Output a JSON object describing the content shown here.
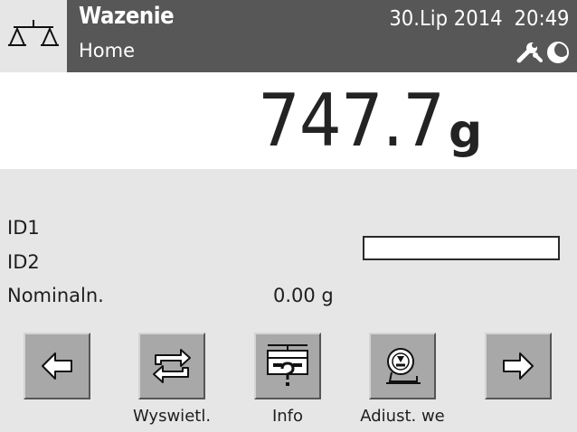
{
  "header": {
    "title": "Wazenie",
    "subtitle": "Home",
    "date": "30.Lip 2014",
    "time": "20:49",
    "icons": [
      "balance-scale-icon",
      "wrench-icon",
      "moon-icon"
    ]
  },
  "weight": {
    "value": "747.7",
    "unit": "g"
  },
  "fields": {
    "id1_label": "ID1",
    "id1_value": "",
    "id2_label": "ID2",
    "nominal_label": "Nominaln.",
    "nominal_value": "0.00 g"
  },
  "function_keys": {
    "back": {
      "label": "",
      "icon": "arrow-left-icon"
    },
    "display": {
      "label": "Wyswietl.",
      "icon": "refresh-cycle-icon"
    },
    "info": {
      "label": "Info",
      "icon": "scale-info-icon"
    },
    "adjust": {
      "label": "Adiust. we",
      "icon": "adjust-weight-icon"
    },
    "next": {
      "label": "",
      "icon": "arrow-right-icon"
    }
  }
}
